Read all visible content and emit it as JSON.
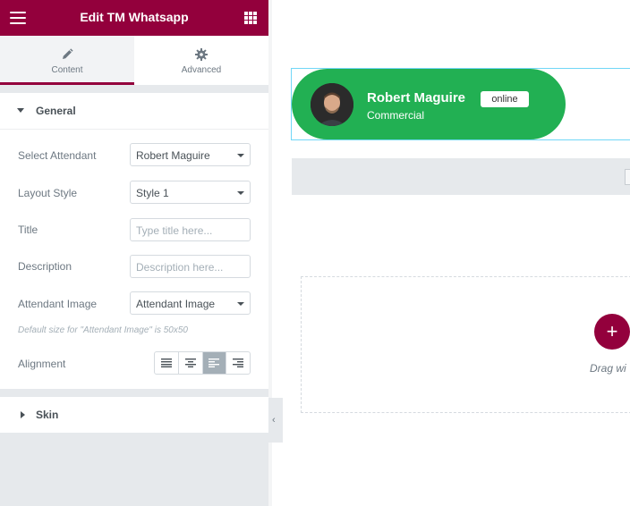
{
  "header": {
    "title": "Edit TM Whatsapp",
    "menu_icon": "hamburger-icon",
    "apps_icon": "grid-icon"
  },
  "tabs": [
    {
      "label": "Content",
      "icon": "pencil-icon",
      "active": true
    },
    {
      "label": "Advanced",
      "icon": "gear-icon",
      "active": false
    }
  ],
  "general": {
    "title": "General",
    "fields": {
      "select_attendant": {
        "label": "Select Attendant",
        "value": "Robert Maguire"
      },
      "layout_style": {
        "label": "Layout Style",
        "value": "Style 1"
      },
      "title": {
        "label": "Title",
        "placeholder": "Type title here..."
      },
      "description": {
        "label": "Description",
        "placeholder": "Description here..."
      },
      "attendant_image": {
        "label": "Attendant Image",
        "value": "Attendant Image"
      }
    },
    "note": "Default size for \"Attendant Image\" is 50x50",
    "alignment": {
      "label": "Alignment",
      "options": [
        "justify",
        "center",
        "left",
        "right"
      ],
      "selected": "left"
    }
  },
  "skin": {
    "title": "Skin"
  },
  "preview": {
    "name": "Robert Maguire",
    "status": "online",
    "role": "Commercial",
    "accent": "#22b053"
  },
  "dropzone": {
    "add_label": "+",
    "drag_text": "Drag wi"
  },
  "colors": {
    "brand": "#93003c",
    "whatsapp_green": "#22b053"
  }
}
